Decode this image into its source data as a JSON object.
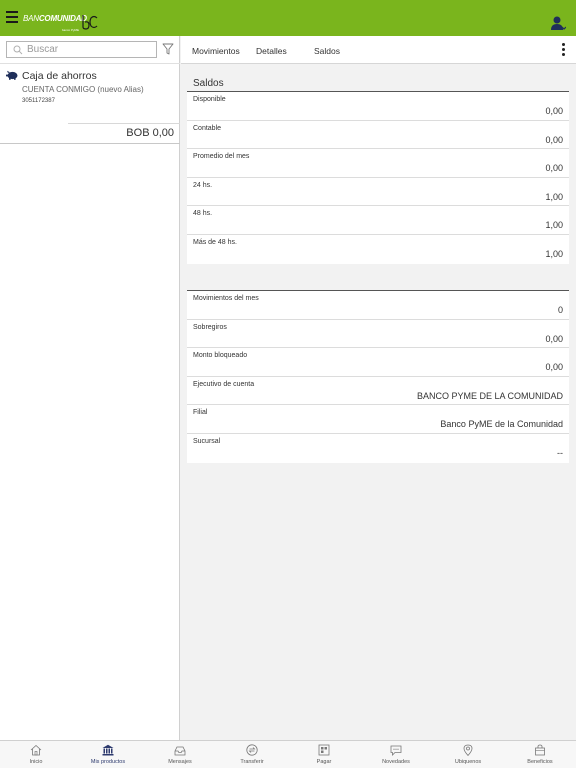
{
  "header": {
    "brand_part1": "BAN",
    "brand_part2": "COMUNIDAD",
    "brand_sub": "banco PyME",
    "colors": {
      "primary": "#7ab51d",
      "nav_active": "#2d3a6e"
    }
  },
  "search": {
    "placeholder": "Buscar"
  },
  "account": {
    "name": "Caja de ahorros",
    "alias": "CUENTA CONMIGO (nuevo Alias)",
    "number": "3051172387",
    "balance": "BOB 0,00",
    "icon": "piggy-bank-icon"
  },
  "tabs": [
    {
      "label": "Movimientos"
    },
    {
      "label": "Detalles"
    },
    {
      "label": "Saldos"
    }
  ],
  "saldos": {
    "title": "Saldos",
    "rows": [
      {
        "label": "Disponible",
        "value": "0,00"
      },
      {
        "label": "Contable",
        "value": "0,00"
      },
      {
        "label": "Promedio del mes",
        "value": "0,00"
      },
      {
        "label": "24 hs.",
        "value": "1,00"
      },
      {
        "label": "48 hs.",
        "value": "1,00"
      },
      {
        "label": "Más de 48 hs.",
        "value": "1,00"
      }
    ]
  },
  "detalles": {
    "rows": [
      {
        "label": "Movimientos del mes",
        "value": "0"
      },
      {
        "label": "Sobregiros",
        "value": "0,00"
      },
      {
        "label": "Monto bloqueado",
        "value": "0,00"
      },
      {
        "label": "Ejecutivo de cuenta",
        "value": "BANCO PYME DE LA COMUNIDAD"
      },
      {
        "label": "Filial",
        "value": "Banco PyME de la Comunidad"
      },
      {
        "label": "Sucursal",
        "value": "--"
      }
    ]
  },
  "bottom_nav": [
    {
      "label": "Inicio",
      "icon": "home-icon"
    },
    {
      "label": "Mis productos",
      "icon": "bank-icon"
    },
    {
      "label": "Mensajes",
      "icon": "inbox-icon"
    },
    {
      "label": "Transferir",
      "icon": "transfer-icon"
    },
    {
      "label": "Pagar",
      "icon": "pay-icon"
    },
    {
      "label": "Novedades",
      "icon": "chat-icon"
    },
    {
      "label": "Ubiquenos",
      "icon": "location-pin-icon"
    },
    {
      "label": "Beneficios",
      "icon": "bag-icon"
    }
  ]
}
